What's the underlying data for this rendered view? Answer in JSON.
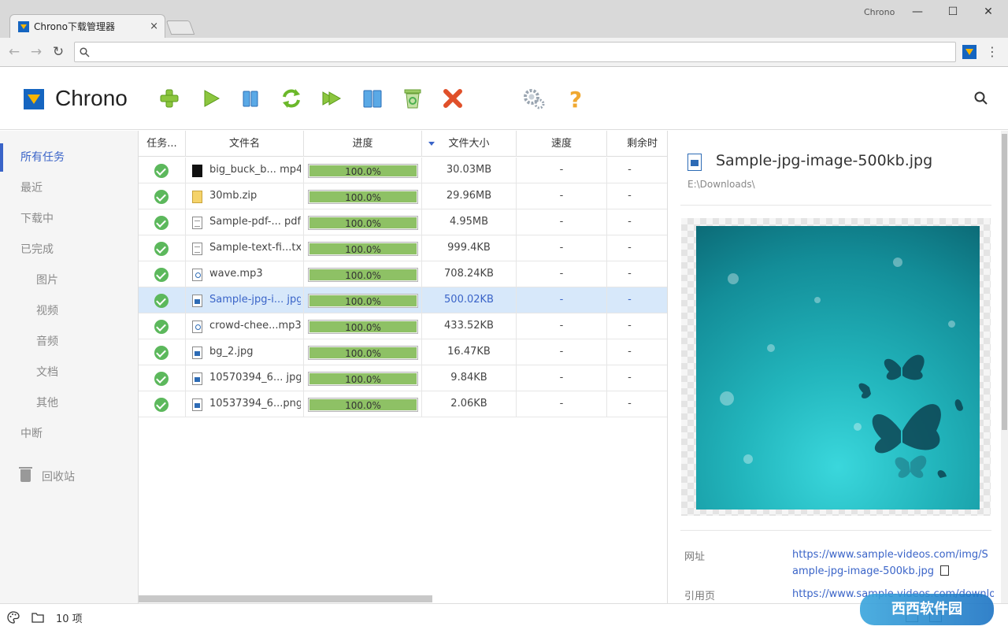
{
  "browser": {
    "tab_title": "Chrono下载管理器",
    "tab_close": "×",
    "app_label": "Chrono",
    "win_minimize": "—",
    "win_maximize": "☐",
    "win_close": "✕",
    "back": "←",
    "forward": "→",
    "reload": "↻",
    "address_value": "",
    "menu": "⋮"
  },
  "header": {
    "brand": "Chrono",
    "tools": [
      "add-icon",
      "start-icon",
      "pause-icon",
      "restart-icon",
      "start-all-icon",
      "pause-all-icon",
      "clear-completed-icon",
      "delete-icon",
      "settings-icon",
      "help-icon"
    ]
  },
  "sidebar": {
    "items": [
      {
        "label": "所有任务",
        "active": true
      },
      {
        "label": "最近"
      },
      {
        "label": "下载中"
      },
      {
        "label": "已完成"
      },
      {
        "label": "图片",
        "sub": true
      },
      {
        "label": "视频",
        "sub": true
      },
      {
        "label": "音频",
        "sub": true
      },
      {
        "label": "文档",
        "sub": true
      },
      {
        "label": "其他",
        "sub": true
      },
      {
        "label": "中断"
      }
    ],
    "trash_label": "回收站"
  },
  "table": {
    "columns": [
      "任务...",
      "文件名",
      "进度",
      "文件大小",
      "速度",
      "剩余时"
    ],
    "rows": [
      {
        "name": "big_buck_b... mp4",
        "type": "video",
        "progress": 1.0,
        "progress_text": "100.0%",
        "size": "30.03MB",
        "speed": "-",
        "remaining": "-"
      },
      {
        "name": "30mb.zip",
        "type": "zip",
        "progress": 1.0,
        "progress_text": "100.0%",
        "size": "29.96MB",
        "speed": "-",
        "remaining": "-"
      },
      {
        "name": "Sample-pdf-... pdf",
        "type": "text",
        "progress": 1.0,
        "progress_text": "100.0%",
        "size": "4.95MB",
        "speed": "-",
        "remaining": "-"
      },
      {
        "name": "Sample-text-fi...txt",
        "type": "text",
        "progress": 1.0,
        "progress_text": "100.0%",
        "size": "999.4KB",
        "speed": "-",
        "remaining": "-"
      },
      {
        "name": "wave.mp3",
        "type": "audio",
        "progress": 1.0,
        "progress_text": "100.0%",
        "size": "708.24KB",
        "speed": "-",
        "remaining": "-"
      },
      {
        "name": "Sample-jpg-i... jpg",
        "type": "image",
        "progress": 1.0,
        "progress_text": "100.0%",
        "size": "500.02KB",
        "speed": "-",
        "remaining": "-",
        "selected": true
      },
      {
        "name": "crowd-chee...mp3",
        "type": "audio",
        "progress": 1.0,
        "progress_text": "100.0%",
        "size": "433.52KB",
        "speed": "-",
        "remaining": "-"
      },
      {
        "name": "bg_2.jpg",
        "type": "image",
        "progress": 1.0,
        "progress_text": "100.0%",
        "size": "16.47KB",
        "speed": "-",
        "remaining": "-"
      },
      {
        "name": "10570394_6... jpg",
        "type": "image",
        "progress": 1.0,
        "progress_text": "100.0%",
        "size": "9.84KB",
        "speed": "-",
        "remaining": "-"
      },
      {
        "name": "10537394_6...png",
        "type": "image",
        "progress": 1.0,
        "progress_text": "100.0%",
        "size": "2.06KB",
        "speed": "-",
        "remaining": "-"
      }
    ],
    "expander": "❭"
  },
  "details": {
    "title": "Sample-jpg-image-500kb.jpg",
    "path": "E:\\Downloads\\",
    "url_label": "网址",
    "url_value": "https://www.sample-videos.com/img/Sample-jpg-image-500kb.jpg",
    "referrer_label": "引用页",
    "referrer_value": "https://www.sample-videos.com/downlo"
  },
  "status": {
    "count": "10 项"
  },
  "watermark": {
    "text": "西西软件园"
  },
  "colors": {
    "accent": "#3a64c8",
    "progress": "#8ec165",
    "success": "#5cb85c",
    "selected_row": "#d7e8fa"
  }
}
